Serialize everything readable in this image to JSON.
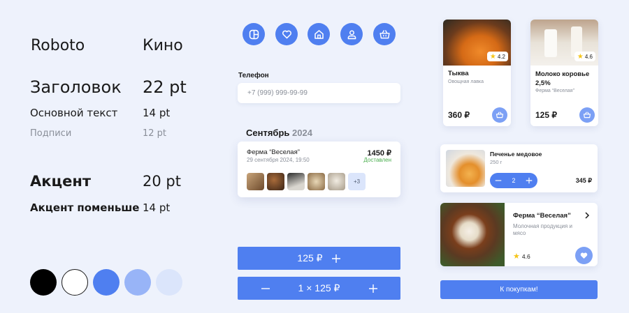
{
  "typography": {
    "font1": "Roboto",
    "font2": "Кино",
    "rows": [
      {
        "label": "Заголовок",
        "size": "22 pt"
      },
      {
        "label": "Основной текст",
        "size": "14 pt"
      },
      {
        "label": "Подписи",
        "size": "12 pt"
      },
      {
        "label": "Акцент",
        "size": "20 pt"
      },
      {
        "label": "Акцент поменьше",
        "size": "14 pt"
      }
    ]
  },
  "palette": [
    "#000000",
    "#ffffff",
    "#4f7ff0",
    "#98b4f7",
    "#dbe5fb"
  ],
  "icons": [
    "grid-icon",
    "heart-icon",
    "home-icon",
    "user-icon",
    "basket-icon"
  ],
  "phone": {
    "label": "Телефон",
    "placeholder": "+7 (999) 999-99-99"
  },
  "orders": {
    "month": "Сентябрь",
    "year": "2024",
    "card": {
      "farm": "Ферма “Веселая”",
      "date": "29 сентября 2024, 19:50",
      "price": "1450 ₽",
      "status": "Доставлен",
      "more": "+3"
    }
  },
  "buttons": {
    "add_price": "125 ₽",
    "qty_price": "1 × 125 ₽",
    "to_shop": "К покупкам!"
  },
  "products": [
    {
      "name": "Тыква",
      "seller": "Овощная лавка",
      "price": "360 ₽",
      "rating": "4.2"
    },
    {
      "name": "Молоко коровье 2,5%",
      "seller": "Ферма “Веселая”",
      "price": "125 ₽",
      "rating": "4.6"
    }
  ],
  "cart_item": {
    "name": "Печенье медовое",
    "weight": "250 г",
    "qty": "2",
    "price": "345 ₽"
  },
  "farm": {
    "name": "Ферма “Веселая”",
    "desc": "Молочная продукция и мясо",
    "rating": "4.6"
  }
}
